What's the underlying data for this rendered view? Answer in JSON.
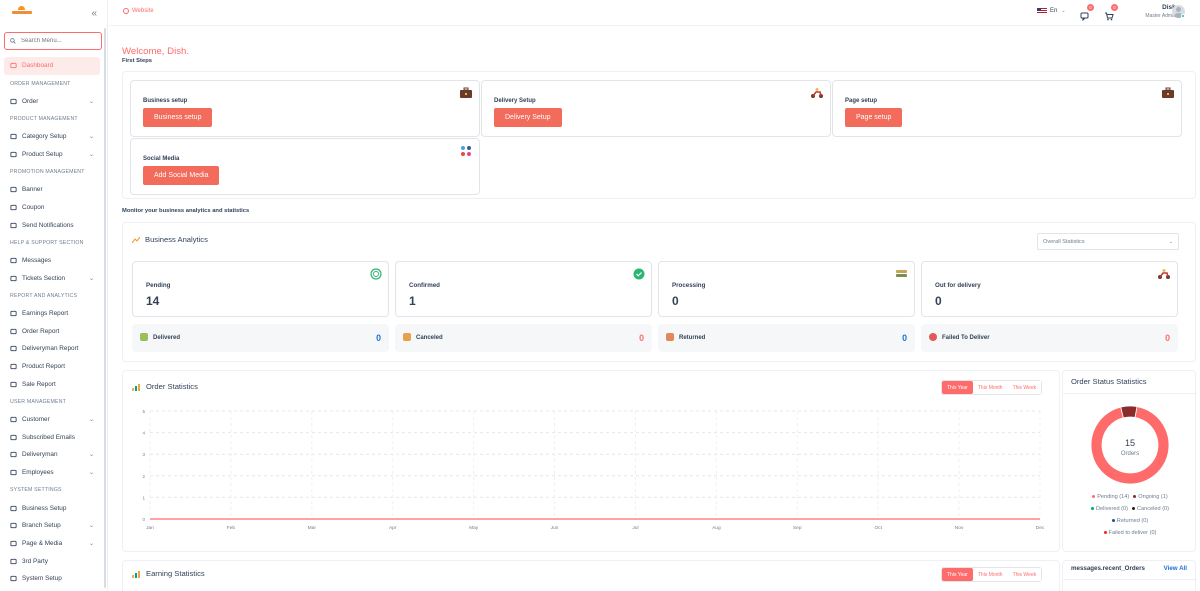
{
  "sidebar": {
    "search_placeholder": "Search Menu...",
    "items": [
      {
        "type": "item",
        "label": "Dashboard",
        "icon": "home-icon",
        "active": true
      },
      {
        "type": "section",
        "label": "ORDER MANAGEMENT"
      },
      {
        "type": "item",
        "label": "Order",
        "icon": "cart-icon",
        "chevron": true
      },
      {
        "type": "section",
        "label": "PRODUCT MANAGEMENT"
      },
      {
        "type": "item",
        "label": "Category Setup",
        "icon": "category-icon",
        "chevron": true
      },
      {
        "type": "item",
        "label": "Product Setup",
        "icon": "product-icon",
        "chevron": true
      },
      {
        "type": "section",
        "label": "PROMOTION MANAGEMENT"
      },
      {
        "type": "item",
        "label": "Banner",
        "icon": "banner-icon"
      },
      {
        "type": "item",
        "label": "Coupon",
        "icon": "coupon-icon"
      },
      {
        "type": "item",
        "label": "Send Notifications",
        "icon": "bell-icon"
      },
      {
        "type": "section",
        "label": "HELP & SUPPORT SECTION"
      },
      {
        "type": "item",
        "label": "Messages",
        "icon": "message-icon"
      },
      {
        "type": "item",
        "label": "Tickets Section",
        "icon": "ticket-icon",
        "chevron": true
      },
      {
        "type": "section",
        "label": "REPORT AND ANALYTICS"
      },
      {
        "type": "item",
        "label": "Earnings Report",
        "icon": "pie-icon"
      },
      {
        "type": "item",
        "label": "Order Report",
        "icon": "bars-icon"
      },
      {
        "type": "item",
        "label": "Deliveryman Report",
        "icon": "circle-icon"
      },
      {
        "type": "item",
        "label": "Product Report",
        "icon": "product-report-icon"
      },
      {
        "type": "item",
        "label": "Sale Report",
        "icon": "sale-icon"
      },
      {
        "type": "section",
        "label": "USER MANAGEMENT"
      },
      {
        "type": "item",
        "label": "Customer",
        "icon": "customer-icon",
        "chevron": true
      },
      {
        "type": "item",
        "label": "Subscribed Emails",
        "icon": "mail-icon"
      },
      {
        "type": "item",
        "label": "Deliveryman",
        "icon": "person-icon",
        "chevron": true
      },
      {
        "type": "item",
        "label": "Employees",
        "icon": "employee-icon",
        "chevron": true
      },
      {
        "type": "section",
        "label": "SYSTEM SETTINGS"
      },
      {
        "type": "item",
        "label": "Business Setup",
        "icon": "gear-icon"
      },
      {
        "type": "item",
        "label": "Branch Setup",
        "icon": "branch-icon",
        "chevron": true
      },
      {
        "type": "item",
        "label": "Page & Media",
        "icon": "page-icon",
        "chevron": true
      },
      {
        "type": "item",
        "label": "3rd Party",
        "icon": "plug-icon"
      },
      {
        "type": "item",
        "label": "System Setup",
        "icon": "system-icon"
      }
    ]
  },
  "topbar": {
    "website_label": "Website",
    "lang_label": "En",
    "messages_count": "0",
    "cart_count": "0",
    "user_name": "Dish",
    "user_role": "Master Admin"
  },
  "main": {
    "welcome": "Welcome, Dish.",
    "first_steps": "First Steps",
    "steps": [
      {
        "title": "Business setup",
        "button": "Business setup",
        "icon": "briefcase-icon"
      },
      {
        "title": "Delivery Setup",
        "button": "Delivery Setup",
        "icon": "scooter-icon"
      },
      {
        "title": "Page setup",
        "button": "Page setup",
        "icon": "briefcase-icon"
      },
      {
        "title": "Social Media",
        "button": "Add Social Media",
        "icon": "social-icon"
      }
    ],
    "monitor_text": "Monitor your business analytics and statistics",
    "analytics": {
      "title": "Business Analytics",
      "select_value": "Overall Statistics",
      "cards": [
        {
          "label": "Pending",
          "value": "14",
          "icon": "pending-icon"
        },
        {
          "label": "Confirmed",
          "value": "1",
          "icon": "confirmed-icon"
        },
        {
          "label": "Processing",
          "value": "0",
          "icon": "processing-icon"
        },
        {
          "label": "Out for delivery",
          "value": "0",
          "icon": "scooter-icon"
        }
      ],
      "mini": [
        {
          "label": "Delivered",
          "value": "0",
          "color": "#1f6fd1",
          "icon": "delivered-icon"
        },
        {
          "label": "Canceled",
          "value": "0",
          "color": "#ff6b6b",
          "icon": "canceled-icon"
        },
        {
          "label": "Returned",
          "value": "0",
          "color": "#1f6fd1",
          "icon": "returned-icon"
        },
        {
          "label": "Failed To Deliver",
          "value": "0",
          "color": "#ff6b6b",
          "icon": "failed-icon"
        }
      ]
    },
    "order_stats": {
      "title": "Order Statistics",
      "tabs": [
        "This Year",
        "This Month",
        "This Week"
      ]
    },
    "order_status": {
      "title": "Order Status Statistics",
      "total": "15",
      "total_label": "Orders",
      "legend": [
        {
          "label": "Pending (14)",
          "color": "#ff6b6b"
        },
        {
          "label": "Ongoing (1)",
          "color": "#8b2c2c"
        },
        {
          "label": "Delivered (0)",
          "color": "#00aa6d"
        },
        {
          "label": "Canceled (0)",
          "color": "#222222"
        },
        {
          "label": "Returned (0)",
          "color": "#1f4e8c"
        },
        {
          "label": "Failed to deliver (0)",
          "color": "#ff1f1f"
        }
      ]
    },
    "earning_stats": {
      "title": "Earning Statistics",
      "tabs": [
        "This Year",
        "This Month",
        "This Week"
      ]
    },
    "recent_orders": {
      "title": "messages.recent_Orders",
      "view_all": "View All"
    }
  },
  "chart_data": [
    {
      "type": "line",
      "title": "Order Statistics",
      "categories": [
        "Jan",
        "Feb",
        "Mar",
        "Apr",
        "May",
        "Jun",
        "Jul",
        "Aug",
        "Sep",
        "Oct",
        "Nov",
        "Dec"
      ],
      "series": [
        {
          "values": [
            0,
            0,
            0,
            0,
            0,
            0,
            0,
            0,
            0,
            0,
            0,
            0
          ],
          "color": "#ff6b6b"
        }
      ],
      "ylim": [
        0,
        5
      ],
      "yticks": [
        "0",
        "1",
        "2",
        "3",
        "4",
        "5"
      ],
      "grid": true
    },
    {
      "type": "pie",
      "title": "Order Status Statistics",
      "categories": [
        "Pending",
        "Ongoing",
        "Delivered",
        "Canceled",
        "Returned",
        "Failed to deliver"
      ],
      "values": [
        14,
        1,
        0,
        0,
        0,
        0
      ],
      "colors": [
        "#ff6b6b",
        "#8b2c2c",
        "#00aa6d",
        "#222222",
        "#1f4e8c",
        "#ff1f1f"
      ]
    }
  ]
}
